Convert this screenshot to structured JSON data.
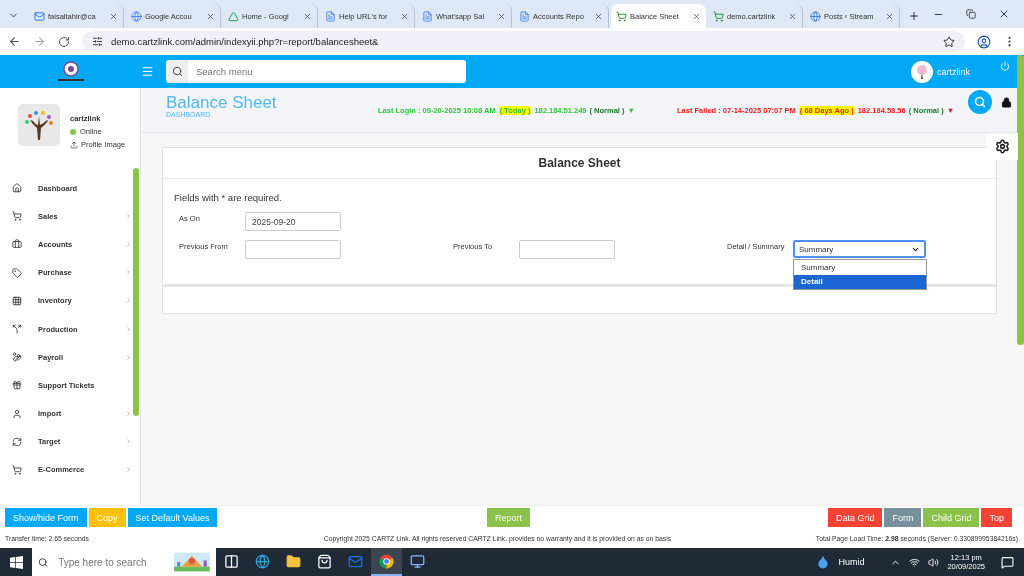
{
  "browser": {
    "tabs": [
      {
        "title": "faisaltahir@ca",
        "selected": false
      },
      {
        "title": "Google Accou",
        "selected": false
      },
      {
        "title": "Home - Googl",
        "selected": false
      },
      {
        "title": "Help URL's for",
        "selected": false
      },
      {
        "title": "What'sapp Sal",
        "selected": false
      },
      {
        "title": "Accounts Repo",
        "selected": false
      },
      {
        "title": "Balance Sheet",
        "selected": true
      },
      {
        "title": "demo.cartzlink",
        "selected": false
      },
      {
        "title": "Posts ‹ Stream",
        "selected": false
      }
    ],
    "url": "demo.cartzlink.com/admin/indexyii.php?r=report/balancesheet&"
  },
  "header": {
    "search_placeholder": "Search menu",
    "user": "cartzlink"
  },
  "sidebar": {
    "user": {
      "name": "cartzlink",
      "status": "Online",
      "online": true,
      "link": "Profile Image"
    },
    "items": [
      {
        "label": "Dashboard",
        "has_submenu": false
      },
      {
        "label": "Sales",
        "has_submenu": true
      },
      {
        "label": "Accounts",
        "has_submenu": true
      },
      {
        "label": "Purchase",
        "has_submenu": true
      },
      {
        "label": "Inventory",
        "has_submenu": true
      },
      {
        "label": "Production",
        "has_submenu": true
      },
      {
        "label": "Payroll",
        "has_submenu": true
      },
      {
        "label": "Support Tickets",
        "has_submenu": false
      },
      {
        "label": "Import",
        "has_submenu": true
      },
      {
        "label": "Target",
        "has_submenu": true
      },
      {
        "label": "E-Commerce",
        "has_submenu": true
      }
    ]
  },
  "page": {
    "title": "Balance Sheet",
    "subtitle": "DASHBOARD",
    "last_login": {
      "label": "Last Login : 09-20-2025 10:08 AM",
      "badge": "( Today )",
      "ip": "182.184.51.249",
      "status": "( Normal )",
      "arrow": "▼"
    },
    "last_failed": {
      "label": "Last Failed : 07-14-2025 07:07 PM",
      "badge": "( 68 Days Ago )",
      "ip": "182.184.58.56",
      "status": "( Normal )",
      "arrow": "▼"
    }
  },
  "form": {
    "title": "Balance Sheet",
    "note": "Fields with * are required.",
    "rows": [
      {
        "fields": [
          {
            "kind": "text",
            "label": "As On",
            "value": "2025-09-20"
          }
        ]
      },
      {
        "fields": [
          {
            "kind": "text",
            "label": "Previous From"
          },
          {
            "kind": "text",
            "label": "Previous To"
          },
          {
            "kind": "select",
            "label": "Detail / Summary",
            "value": "Summary",
            "expanded": true,
            "options": [
              {
                "label": "Summary",
                "highlighted": false
              },
              {
                "label": "Detail",
                "highlighted": true
              }
            ]
          }
        ]
      }
    ]
  },
  "action_buttons": {
    "left": [
      {
        "label": "Show/hide Form",
        "color": "#03a9f4"
      },
      {
        "label": "Copy",
        "color": "#ffc107"
      },
      {
        "label": "Set Default Values",
        "color": "#03a9f4"
      }
    ],
    "center": [
      {
        "label": "Report",
        "color": "#8bc34a"
      }
    ],
    "right": [
      {
        "label": "Data Grid",
        "color": "#f44336"
      },
      {
        "label": "Form",
        "color": "#78909c"
      },
      {
        "label": "Child Grid",
        "color": "#8bc34a"
      },
      {
        "label": "Top",
        "color": "#f44336"
      }
    ]
  },
  "status": {
    "transfer": "Transfer time: 2.65 seconds",
    "copyright": "Copyright 2025 CARTZ Link. All rights reserved CARTZ Link. provides no warranty and it is provided on as on basis",
    "load_time": "Total Page Load Time: **2.98** seconds (Server: 0.33089995384216s)"
  },
  "taskbar": {
    "search_placeholder": "Type here to search",
    "apps": [
      {
        "active": false
      },
      {
        "active": false
      },
      {
        "active": false
      },
      {
        "active": false
      },
      {
        "active": false
      },
      {
        "active": true
      },
      {
        "active": false
      }
    ],
    "weather": "Humid",
    "time": "12:13 pm",
    "date": "20/09/2025"
  }
}
